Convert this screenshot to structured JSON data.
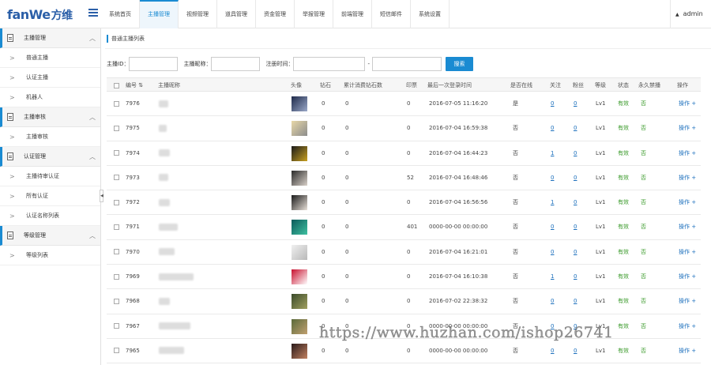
{
  "app": {
    "logo_text": "fanWe",
    "logo_cn": "方维",
    "user": "admin"
  },
  "nav": [
    {
      "label": "系统首页",
      "active": false
    },
    {
      "label": "主播管理",
      "active": true
    },
    {
      "label": "视频管理",
      "active": false
    },
    {
      "label": "道具管理",
      "active": false
    },
    {
      "label": "资金管理",
      "active": false
    },
    {
      "label": "举报管理",
      "active": false
    },
    {
      "label": "前端管理",
      "active": false
    },
    {
      "label": "短信邮件",
      "active": false
    },
    {
      "label": "系统设置",
      "active": false
    }
  ],
  "sidebar": {
    "groups": [
      {
        "label": "主播管理",
        "items": [
          "普通主播",
          "认证主播",
          "机器人"
        ]
      },
      {
        "label": "主播审核",
        "items": [
          "主播审核"
        ]
      },
      {
        "label": "认证管理",
        "items": [
          "主播待审认证",
          "所有认证",
          "认证名称列表"
        ]
      },
      {
        "label": "等级管理",
        "items": [
          "等级列表"
        ]
      }
    ]
  },
  "breadcrumb": "普通主播列表",
  "filter": {
    "id_label": "主播ID：",
    "nick_label": "主播昵称：",
    "time_label": "注册时间：",
    "sep": "-",
    "search_label": "搜索"
  },
  "table": {
    "headers": {
      "id": "编号",
      "nick": "主播昵称",
      "avatar": "头像",
      "diamonds": "钻石",
      "acc": "累计消费钻石数",
      "ticket": "印票",
      "last": "最后一次登录时间",
      "online": "是否在线",
      "follow": "关注",
      "fans": "粉丝",
      "level": "等级",
      "status": "状态",
      "perm": "永久禁播",
      "op": "操作"
    },
    "rows": [
      {
        "id": "7976",
        "diamonds": "0",
        "acc": "0",
        "ticket": "0",
        "last": "2016-07-05 11:16:20",
        "online": "是",
        "follow": "0",
        "fans": "0",
        "level": "Lv1",
        "status": "有效",
        "perm": "否",
        "op": "操作 +",
        "thumb": [
          "#1e2a4a",
          "#9aa8c8"
        ]
      },
      {
        "id": "7975",
        "diamonds": "0",
        "acc": "0",
        "ticket": "0",
        "last": "2016-07-04 16:59:38",
        "online": "否",
        "follow": "0",
        "fans": "0",
        "level": "Lv1",
        "status": "有效",
        "perm": "否",
        "op": "操作 +",
        "thumb": [
          "#e8d8a8",
          "#8c8c8c"
        ]
      },
      {
        "id": "7974",
        "diamonds": "0",
        "acc": "0",
        "ticket": "0",
        "last": "2016-07-04 16:44:23",
        "online": "否",
        "follow": "1",
        "fans": "0",
        "level": "Lv1",
        "status": "有效",
        "perm": "否",
        "op": "操作 +",
        "thumb": [
          "#1a1a1a",
          "#c8a020"
        ]
      },
      {
        "id": "7973",
        "diamonds": "0",
        "acc": "0",
        "ticket": "52",
        "last": "2016-07-04 16:48:46",
        "online": "否",
        "follow": "0",
        "fans": "0",
        "level": "Lv1",
        "status": "有效",
        "perm": "否",
        "op": "操作 +",
        "thumb": [
          "#2a2a2a",
          "#d8d0c8"
        ]
      },
      {
        "id": "7972",
        "diamonds": "0",
        "acc": "0",
        "ticket": "0",
        "last": "2016-07-04 16:56:56",
        "online": "否",
        "follow": "1",
        "fans": "0",
        "level": "Lv1",
        "status": "有效",
        "perm": "否",
        "op": "操作 +",
        "thumb": [
          "#1a1a1a",
          "#e8e0d8"
        ]
      },
      {
        "id": "7971",
        "diamonds": "0",
        "acc": "0",
        "ticket": "401",
        "last": "0000-00-00 00:00:00",
        "online": "否",
        "follow": "0",
        "fans": "0",
        "level": "Lv1",
        "status": "有效",
        "perm": "否",
        "op": "操作 +",
        "thumb": [
          "#0a5a5a",
          "#40c0a0"
        ]
      },
      {
        "id": "7970",
        "diamonds": "0",
        "acc": "0",
        "ticket": "0",
        "last": "2016-07-04 16:21:01",
        "online": "否",
        "follow": "0",
        "fans": "0",
        "level": "Lv1",
        "status": "有效",
        "perm": "否",
        "op": "操作 +",
        "thumb": [
          "#f0f0f0",
          "#b8b8b8"
        ]
      },
      {
        "id": "7969",
        "diamonds": "0",
        "acc": "0",
        "ticket": "0",
        "last": "2016-07-04 16:10:38",
        "online": "否",
        "follow": "1",
        "fans": "0",
        "level": "Lv1",
        "status": "有效",
        "perm": "否",
        "op": "操作 +",
        "thumb": [
          "#c8102e",
          "#ffffff"
        ]
      },
      {
        "id": "7968",
        "diamonds": "0",
        "acc": "0",
        "ticket": "0",
        "last": "2016-07-02 22:38:32",
        "online": "否",
        "follow": "0",
        "fans": "0",
        "level": "Lv1",
        "status": "有效",
        "perm": "否",
        "op": "操作 +",
        "thumb": [
          "#3a4a2a",
          "#a0a060"
        ]
      },
      {
        "id": "7967",
        "diamonds": "0",
        "acc": "0",
        "ticket": "0",
        "last": "0000-00-00 00:00:00",
        "online": "否",
        "follow": "0",
        "fans": "0",
        "level": "Lv1",
        "status": "有效",
        "perm": "否",
        "op": "操作 +",
        "thumb": [
          "#5a6a3a",
          "#c0a070"
        ]
      },
      {
        "id": "7965",
        "diamonds": "0",
        "acc": "0",
        "ticket": "0",
        "last": "0000-00-00 00:00:00",
        "online": "否",
        "follow": "0",
        "fans": "0",
        "level": "Lv1",
        "status": "有效",
        "perm": "否",
        "op": "操作 +",
        "thumb": [
          "#2a1a1a",
          "#c08060"
        ]
      }
    ]
  },
  "watermark": "https://www.huzhan.com/ishop26741"
}
